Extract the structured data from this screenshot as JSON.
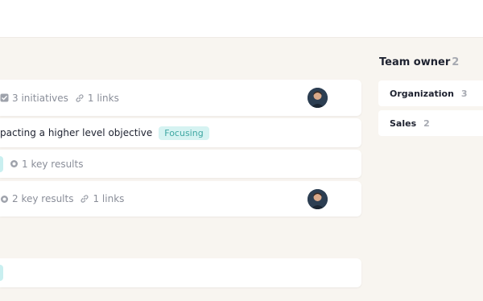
{
  "rows": [
    {
      "initiatives": "3 initiatives",
      "links": "1 links"
    },
    {
      "title": "pacting a higher level objective",
      "badge": "Focusing"
    },
    {
      "key_results": "1 key results"
    },
    {
      "key_results": "2 key results",
      "links": "1 links"
    }
  ],
  "team_owner": {
    "title": "Team owner",
    "count": "2",
    "items": [
      {
        "label": "Organization",
        "count": "3"
      },
      {
        "label": "Sales",
        "count": "2"
      }
    ]
  },
  "colors": {
    "accent": "#3fa7a2",
    "badge_bg": "#d6f3f2",
    "background": "#f8f5f0"
  }
}
